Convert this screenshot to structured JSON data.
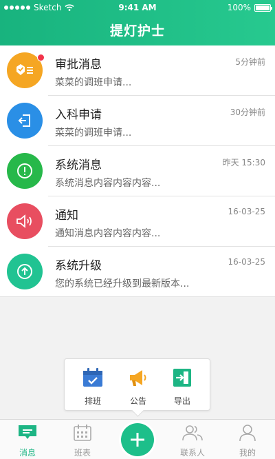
{
  "statusbar": {
    "carrier": "Sketch",
    "time": "9:41 AM",
    "battery": "100%"
  },
  "header": {
    "title": "提灯护士"
  },
  "messages": [
    {
      "title": "审批消息",
      "time": "5分钟前",
      "preview": "菜菜的调班申请...",
      "color": "#f5a623",
      "icon": "approval-icon",
      "unread": true
    },
    {
      "title": "入科申请",
      "time": "30分钟前",
      "preview": "菜菜的调班申请...",
      "color": "#2a8fe6",
      "icon": "enter-department-icon",
      "unread": false
    },
    {
      "title": "系统消息",
      "time": "昨天 15:30",
      "preview": "系统消息内容内容内容...",
      "color": "#27b84a",
      "icon": "alert-icon",
      "unread": false
    },
    {
      "title": "通知",
      "time": "16-03-25",
      "preview": "通知消息内容内容内容...",
      "color": "#e84e60",
      "icon": "speaker-icon",
      "unread": false
    },
    {
      "title": "系统升级",
      "time": "16-03-25",
      "preview": "您的系统已经升级到最新版本...",
      "color": "#21c392",
      "icon": "upgrade-icon",
      "unread": false
    }
  ],
  "popup": {
    "items": [
      {
        "label": "排班",
        "icon": "calendar-check-icon"
      },
      {
        "label": "公告",
        "icon": "megaphone-icon"
      },
      {
        "label": "导出",
        "icon": "export-icon"
      }
    ]
  },
  "tabbar": {
    "items": [
      {
        "label": "消息",
        "icon": "message-icon",
        "active": true
      },
      {
        "label": "班表",
        "icon": "schedule-icon",
        "active": false
      },
      {
        "label": "",
        "icon": "plus-icon",
        "active": false
      },
      {
        "label": "联系人",
        "icon": "contacts-icon",
        "active": false
      },
      {
        "label": "我的",
        "icon": "profile-icon",
        "active": false
      }
    ]
  },
  "colors": {
    "primary": "#1db584",
    "badge": "#f2344b"
  }
}
